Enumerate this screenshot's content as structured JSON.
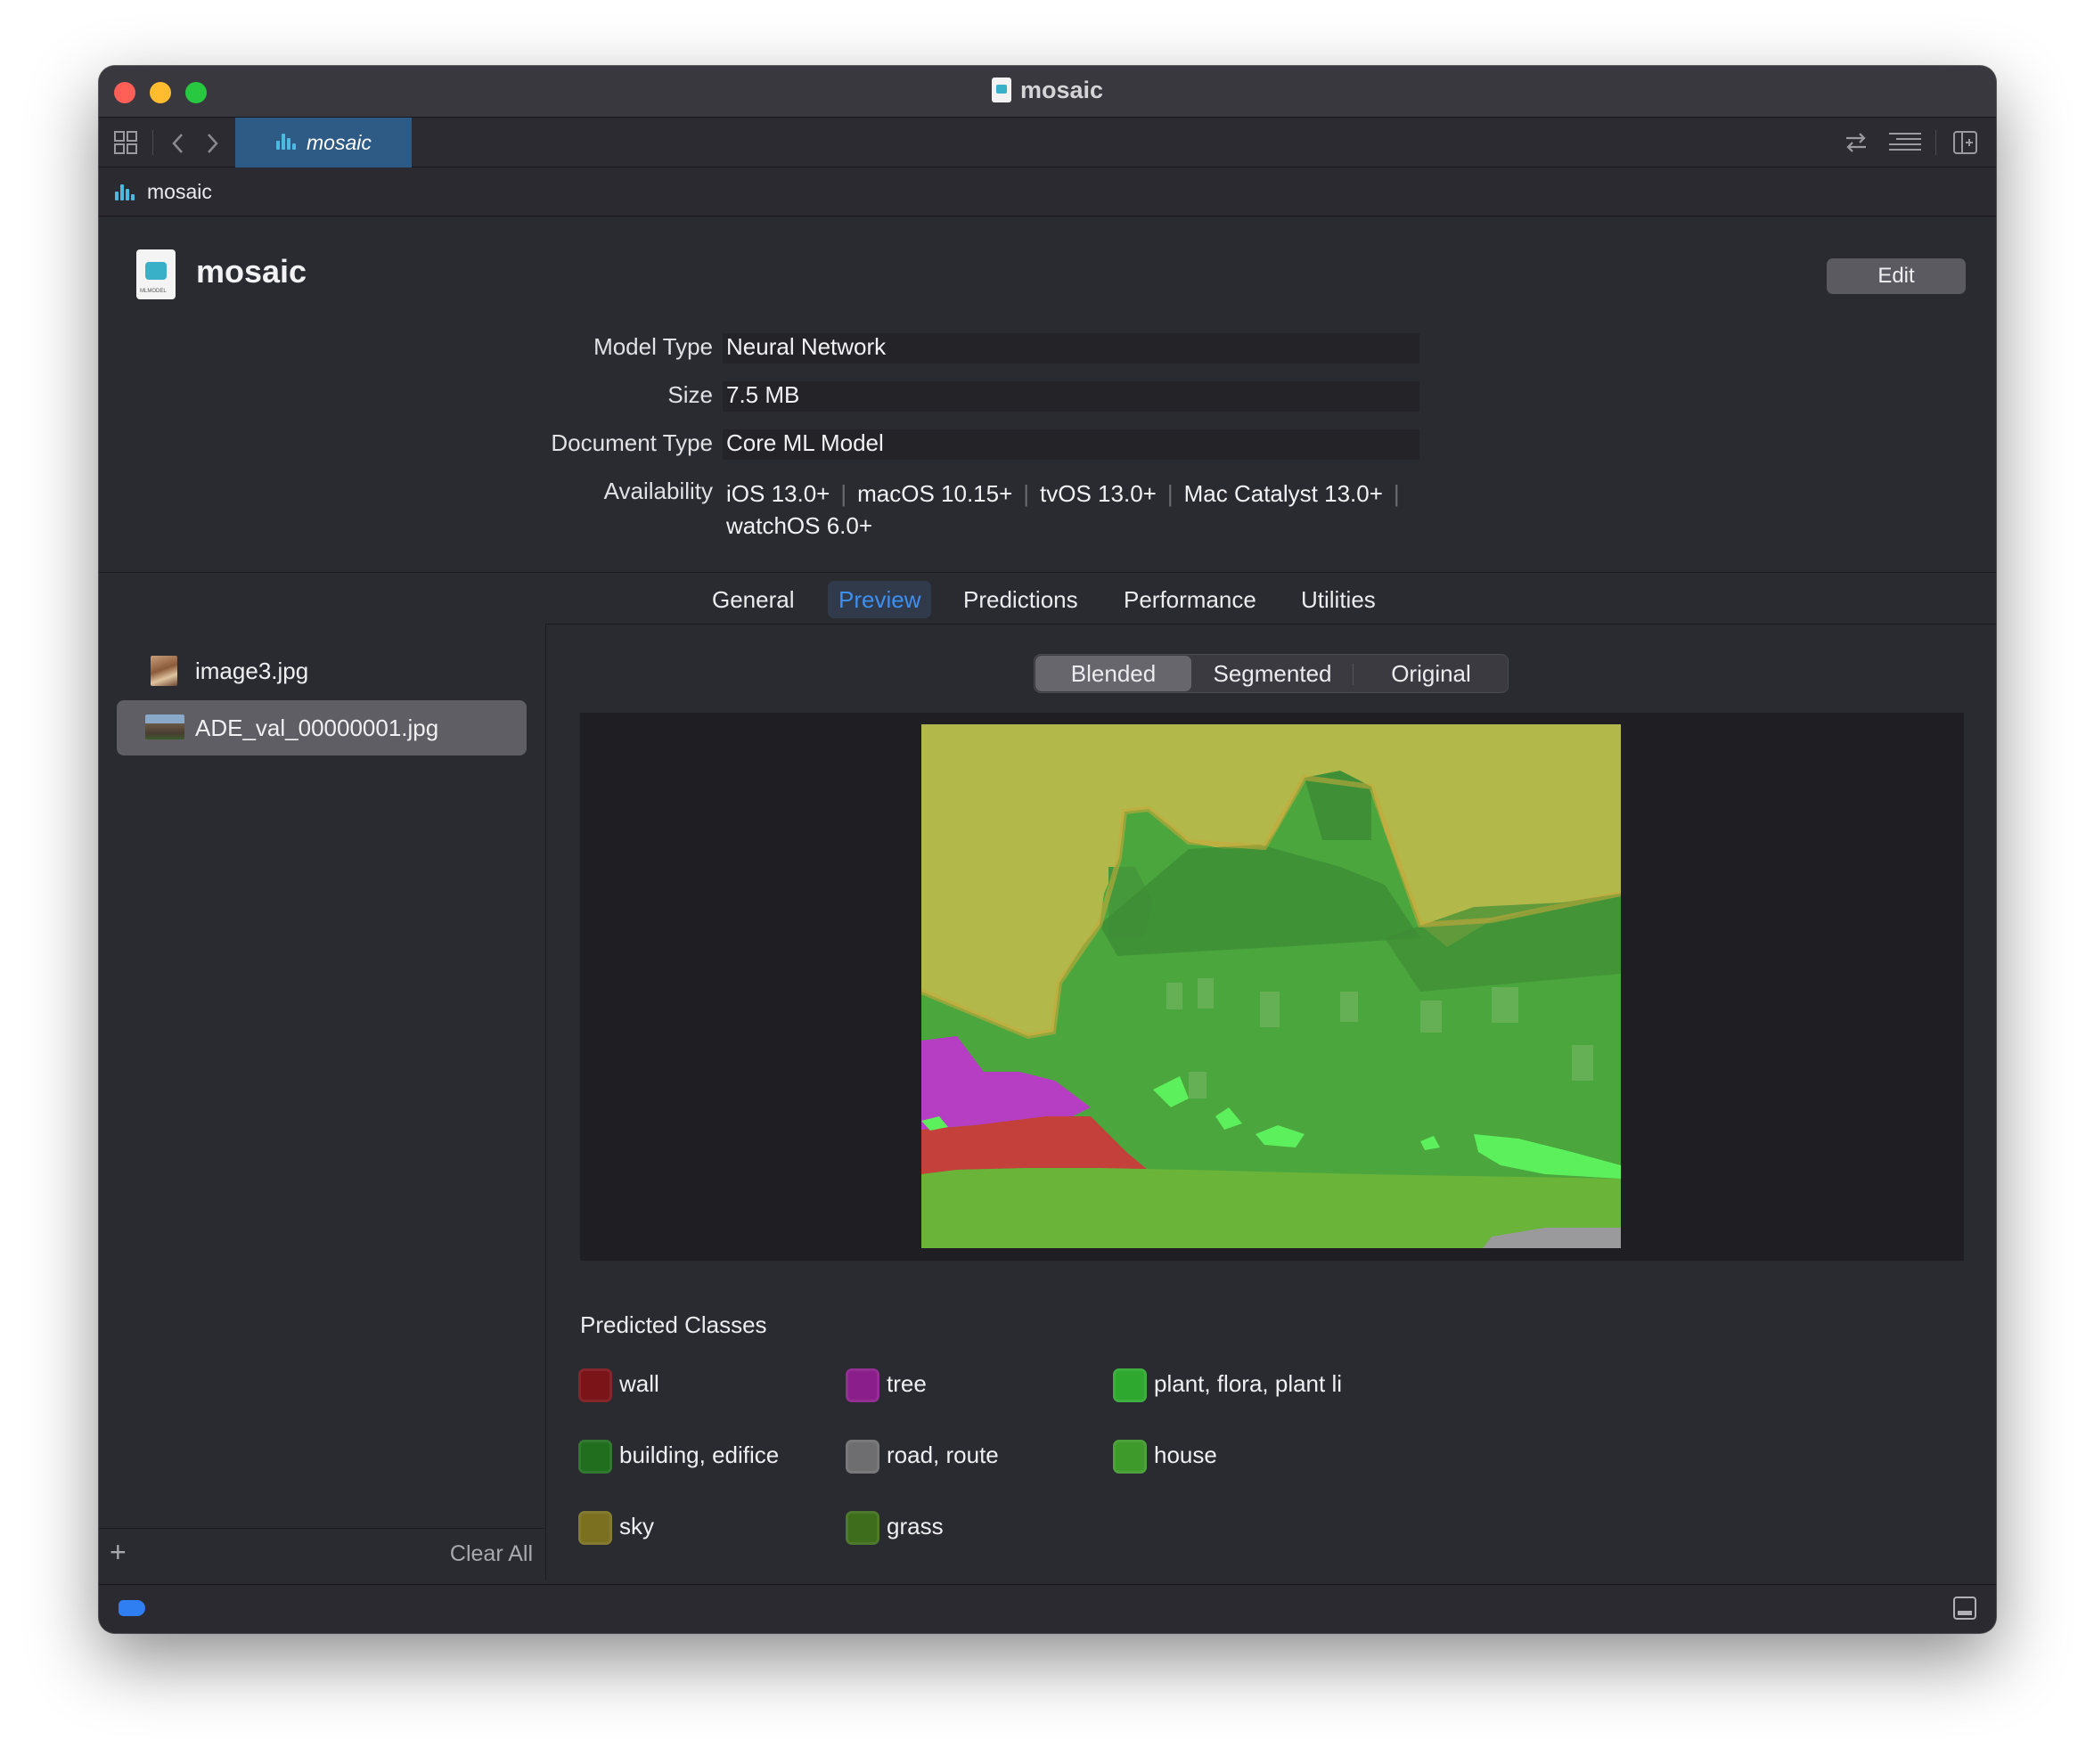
{
  "window": {
    "title": "mosaic"
  },
  "tabbar": {
    "active_tab": "mosaic"
  },
  "breadcrumb": {
    "label": "mosaic"
  },
  "header": {
    "title": "mosaic",
    "edit_label": "Edit"
  },
  "info": {
    "model_type_label": "Model Type",
    "model_type_value": "Neural Network",
    "size_label": "Size",
    "size_value": "7.5 MB",
    "doc_type_label": "Document Type",
    "doc_type_value": "Core ML Model",
    "availability_label": "Availability",
    "availability": [
      "iOS 13.0+",
      "macOS 10.15+",
      "tvOS 13.0+",
      "Mac Catalyst 13.0+",
      "watchOS 6.0+"
    ]
  },
  "tabs": [
    "General",
    "Preview",
    "Predictions",
    "Performance",
    "Utilities"
  ],
  "active_tab": "Preview",
  "sidebar": {
    "files": [
      "image3.jpg",
      "ADE_val_00000001.jpg"
    ],
    "selected": "ADE_val_00000001.jpg",
    "clear_all_label": "Clear All"
  },
  "preview": {
    "modes": [
      "Blended",
      "Segmented",
      "Original"
    ],
    "active_mode": "Blended"
  },
  "predicted": {
    "title": "Predicted Classes",
    "classes": [
      {
        "label": "wall",
        "color": "#7a1418"
      },
      {
        "label": "tree",
        "color": "#8a1e8a"
      },
      {
        "label": "plant, flora, plant li",
        "color": "#2ea82e"
      },
      {
        "label": "building, edifice",
        "color": "#206e1e"
      },
      {
        "label": "road, route",
        "color": "#6e6e70"
      },
      {
        "label": "house",
        "color": "#3e9a2a"
      },
      {
        "label": "sky",
        "color": "#7a7020"
      },
      {
        "label": "grass",
        "color": "#3e6e1c"
      }
    ]
  },
  "colors": {
    "accent": "#3d8ff0",
    "tab_active_bg": "#2e5a86"
  }
}
